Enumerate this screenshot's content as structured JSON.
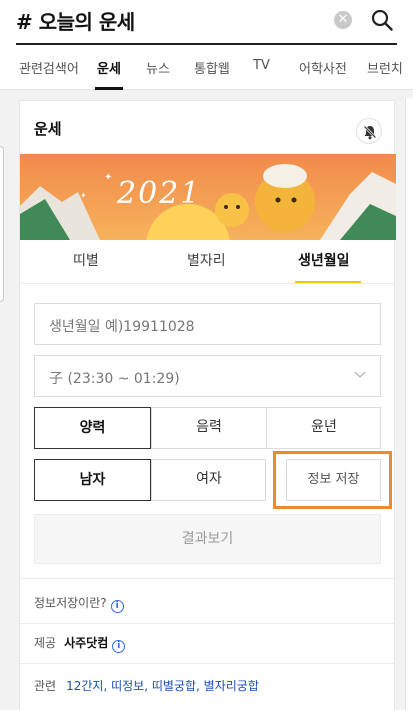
{
  "search": {
    "query": "# 오늘의 운세",
    "clear_icon": "clear-circle-icon",
    "search_icon": "search-icon"
  },
  "tabs": [
    {
      "label": "관련검색어",
      "active": false
    },
    {
      "label": "운세",
      "active": true
    },
    {
      "label": "뉴스",
      "active": false
    },
    {
      "label": "통합웹",
      "active": false
    },
    {
      "label": "TV",
      "active": false
    },
    {
      "label": "어학사전",
      "active": false
    },
    {
      "label": "브런치",
      "active": false
    }
  ],
  "card": {
    "title": "운세",
    "bell_icon": "notification-off-icon",
    "banner_text": "2021",
    "subtabs": [
      {
        "label": "띠별",
        "active": false
      },
      {
        "label": "별자리",
        "active": false
      },
      {
        "label": "생년월일",
        "active": true
      }
    ],
    "birthdate_placeholder": "생년월일 예)19911028",
    "time_select": "子 (23:30 ~ 01:29)",
    "calendar_options": [
      "양력",
      "음력",
      "윤년"
    ],
    "calendar_selected": "양력",
    "gender_options": [
      "남자",
      "여자"
    ],
    "gender_selected": "남자",
    "save_label": "정보 저장",
    "result_label": "결과보기",
    "info_label": "정보저장이란?",
    "provider_label": "제공",
    "provider_name": "사주닷컴",
    "related_label": "관련",
    "related_links": [
      "12간지",
      "띠정보",
      "띠별궁합",
      "별자리궁합"
    ]
  },
  "colors": {
    "highlight": "#ef8a2c",
    "active_subtab": "#f7c600",
    "link": "#1a4fb6"
  }
}
